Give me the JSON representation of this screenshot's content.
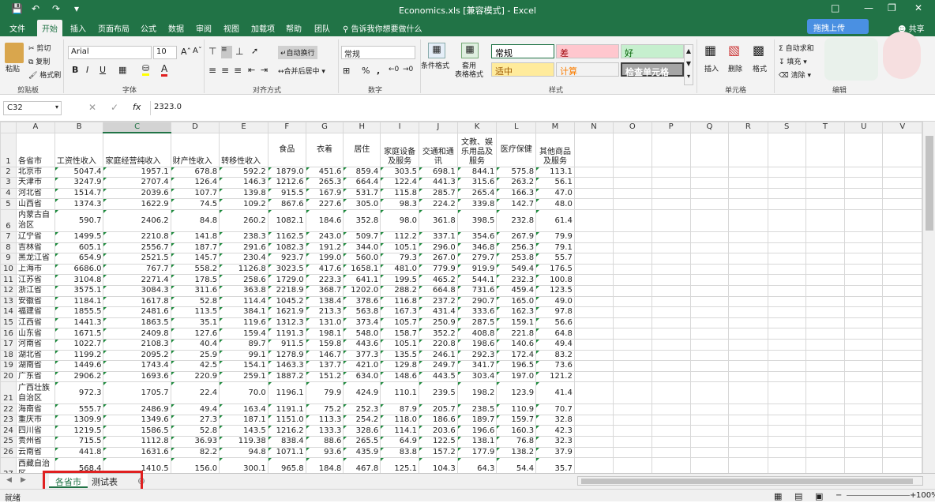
{
  "window": {
    "title": "Economics.xls  [兼容模式]  -  Excel"
  },
  "tabs": [
    "文件",
    "开始",
    "插入",
    "页面布局",
    "公式",
    "数据",
    "审阅",
    "视图",
    "加载项",
    "帮助",
    "团队"
  ],
  "active_tab": "开始",
  "tell_me": "告诉我你想要做什么",
  "share": "共享",
  "upload": "拖拽上传",
  "ribbon": {
    "clipboard": {
      "paste": "粘贴",
      "cut": "剪切",
      "copy": "复制",
      "format_painter": "格式刷",
      "label": "剪贴板"
    },
    "font": {
      "name": "Arial",
      "size": "10",
      "bold": "B",
      "italic": "I",
      "underline": "U",
      "label": "字体"
    },
    "alignment": {
      "wrap": "自动换行",
      "merge": "合并后居中",
      "label": "对齐方式"
    },
    "number": {
      "format": "常规",
      "percent": "%",
      "comma": ",",
      "label": "数字"
    },
    "styles": {
      "conditional": "条件格式",
      "table": "套用\n表格格式",
      "label": "样式",
      "cells": [
        {
          "text": "常规",
          "bg": "#ffffff",
          "fg": "#000000"
        },
        {
          "text": "差",
          "bg": "#ffc7ce",
          "fg": "#9c0006"
        },
        {
          "text": "好",
          "bg": "#c6efce",
          "fg": "#006100"
        },
        {
          "text": "适中",
          "bg": "#ffeb9c",
          "fg": "#9c5700"
        },
        {
          "text": "计算",
          "bg": "#f2f2f2",
          "fg": "#fa7d00"
        },
        {
          "text": "检查单元格",
          "bg": "#a5a5a5",
          "fg": "#ffffff"
        }
      ]
    },
    "cells": {
      "insert": "插入",
      "delete": "删除",
      "format": "格式",
      "label": "单元格"
    },
    "editing": {
      "autosum": "自动求和",
      "fill": "填充",
      "clear": "清除",
      "label": "编辑"
    }
  },
  "formula_bar": {
    "name_box": "C32",
    "fx": "fx",
    "value": "2323.0"
  },
  "columns": [
    "A",
    "B",
    "C",
    "D",
    "E",
    "F",
    "G",
    "H",
    "I",
    "J",
    "K",
    "L",
    "M",
    "N",
    "O",
    "P",
    "Q",
    "R",
    "S",
    "T",
    "U",
    "V"
  ],
  "header_row": [
    "各省市",
    "工资性收入",
    "家庭经营纯收入",
    "财产性收入",
    "转移性收入",
    "食品",
    "衣着",
    "居住",
    "家庭设备及服务",
    "交通和通讯",
    "文教、娱乐用品及服务",
    "医疗保健",
    "其他商品及服务"
  ],
  "rows": [
    {
      "n": "2",
      "name": "北京市",
      "v": [
        "5047.4",
        "1957.1",
        "678.8",
        "592.2",
        "1879.0",
        "451.6",
        "859.4",
        "303.5",
        "698.1",
        "844.1",
        "575.8",
        "113.1"
      ]
    },
    {
      "n": "3",
      "name": "天津市",
      "v": [
        "3247.9",
        "2707.4",
        "126.4",
        "146.3",
        "1212.6",
        "265.3",
        "664.4",
        "122.4",
        "441.3",
        "315.6",
        "263.2",
        "56.1"
      ]
    },
    {
      "n": "4",
      "name": "河北省",
      "v": [
        "1514.7",
        "2039.6",
        "107.7",
        "139.8",
        "915.5",
        "167.9",
        "531.7",
        "115.8",
        "285.7",
        "265.4",
        "166.3",
        "47.0"
      ]
    },
    {
      "n": "5",
      "name": "山西省",
      "v": [
        "1374.3",
        "1622.9",
        "74.5",
        "109.2",
        "867.6",
        "227.6",
        "305.0",
        "98.3",
        "224.2",
        "339.8",
        "142.7",
        "48.0"
      ]
    },
    {
      "n": "6",
      "name": "内蒙古自治区",
      "tall": true,
      "v": [
        "590.7",
        "2406.2",
        "84.8",
        "260.2",
        "1082.1",
        "184.6",
        "352.8",
        "98.0",
        "361.8",
        "398.5",
        "232.8",
        "61.4"
      ]
    },
    {
      "n": "7",
      "name": "辽宁省",
      "v": [
        "1499.5",
        "2210.8",
        "141.8",
        "238.3",
        "1162.5",
        "243.0",
        "509.7",
        "112.2",
        "337.1",
        "354.6",
        "267.9",
        "79.9"
      ]
    },
    {
      "n": "8",
      "name": "吉林省",
      "v": [
        "605.1",
        "2556.7",
        "187.7",
        "291.6",
        "1082.3",
        "191.2",
        "344.0",
        "105.1",
        "296.0",
        "346.8",
        "256.3",
        "79.1"
      ]
    },
    {
      "n": "9",
      "name": "黑龙江省",
      "v": [
        "654.9",
        "2521.5",
        "145.7",
        "230.4",
        "923.7",
        "199.0",
        "560.0",
        "79.3",
        "267.0",
        "279.7",
        "253.8",
        "55.7"
      ]
    },
    {
      "n": "10",
      "name": "上海市",
      "v": [
        "6686.0",
        "767.7",
        "558.2",
        "1126.8",
        "3023.5",
        "417.6",
        "1658.1",
        "481.0",
        "779.9",
        "919.9",
        "549.4",
        "176.5"
      ]
    },
    {
      "n": "11",
      "name": "江苏省",
      "v": [
        "3104.8",
        "2271.4",
        "178.5",
        "258.6",
        "1729.0",
        "223.3",
        "641.1",
        "199.5",
        "465.2",
        "544.1",
        "232.3",
        "100.8"
      ]
    },
    {
      "n": "12",
      "name": "浙江省",
      "v": [
        "3575.1",
        "3084.3",
        "311.6",
        "363.8",
        "2218.9",
        "368.7",
        "1202.0",
        "288.2",
        "664.8",
        "731.6",
        "459.4",
        "123.5"
      ]
    },
    {
      "n": "13",
      "name": "安徽省",
      "v": [
        "1184.1",
        "1617.8",
        "52.8",
        "114.4",
        "1045.2",
        "138.4",
        "378.6",
        "116.8",
        "237.2",
        "290.7",
        "165.0",
        "49.0"
      ]
    },
    {
      "n": "14",
      "name": "福建省",
      "v": [
        "1855.5",
        "2481.6",
        "113.5",
        "384.1",
        "1621.9",
        "213.3",
        "563.8",
        "167.3",
        "431.4",
        "333.6",
        "162.3",
        "97.8"
      ]
    },
    {
      "n": "15",
      "name": "江西省",
      "v": [
        "1441.3",
        "1863.5",
        "35.1",
        "119.6",
        "1312.3",
        "131.0",
        "373.4",
        "105.7",
        "250.9",
        "287.5",
        "159.1",
        "56.6"
      ]
    },
    {
      "n": "16",
      "name": "山东省",
      "v": [
        "1671.5",
        "2409.8",
        "127.6",
        "159.4",
        "1191.3",
        "198.1",
        "548.0",
        "158.7",
        "352.2",
        "408.8",
        "221.8",
        "64.8"
      ]
    },
    {
      "n": "17",
      "name": "河南省",
      "v": [
        "1022.7",
        "2108.3",
        "40.4",
        "89.7",
        "911.5",
        "159.8",
        "443.6",
        "105.1",
        "220.8",
        "198.6",
        "140.6",
        "49.4"
      ]
    },
    {
      "n": "18",
      "name": "湖北省",
      "v": [
        "1199.2",
        "2095.2",
        "25.9",
        "99.1",
        "1278.9",
        "146.7",
        "377.3",
        "135.5",
        "246.1",
        "292.3",
        "172.4",
        "83.2"
      ]
    },
    {
      "n": "19",
      "name": "湖南省",
      "v": [
        "1449.6",
        "1743.4",
        "42.5",
        "154.1",
        "1463.3",
        "137.7",
        "421.0",
        "129.8",
        "249.7",
        "341.7",
        "196.5",
        "73.6"
      ]
    },
    {
      "n": "20",
      "name": "广东省",
      "v": [
        "2906.2",
        "1693.6",
        "220.9",
        "259.1",
        "1887.2",
        "151.2",
        "634.0",
        "148.6",
        "443.5",
        "303.4",
        "197.0",
        "121.2"
      ]
    },
    {
      "n": "21",
      "name": "广西壮族自治区",
      "tall": true,
      "v": [
        "972.3",
        "1705.7",
        "22.4",
        "70.0",
        "1196.1",
        "79.9",
        "424.9",
        "110.1",
        "239.5",
        "198.2",
        "123.9",
        "41.4"
      ]
    },
    {
      "n": "22",
      "name": "海南省",
      "v": [
        "555.7",
        "2486.9",
        "49.4",
        "163.4",
        "1191.1",
        "75.2",
        "252.3",
        "87.9",
        "205.7",
        "238.5",
        "110.9",
        "70.7"
      ]
    },
    {
      "n": "23",
      "name": "重庆市",
      "v": [
        "1309.9",
        "1349.6",
        "27.3",
        "187.1",
        "1151.0",
        "113.3",
        "254.2",
        "118.0",
        "186.6",
        "189.7",
        "159.7",
        "32.8"
      ]
    },
    {
      "n": "24",
      "name": "四川省",
      "v": [
        "1219.5",
        "1586.5",
        "52.8",
        "143.5",
        "1216.2",
        "133.3",
        "328.6",
        "114.1",
        "203.6",
        "196.6",
        "160.3",
        "42.3"
      ]
    },
    {
      "n": "25",
      "name": "贵州省",
      "v": [
        "715.5",
        "1112.8",
        "36.93",
        "119.38",
        "838.4",
        "88.6",
        "265.5",
        "64.9",
        "122.5",
        "138.1",
        "76.8",
        "32.3"
      ]
    },
    {
      "n": "26",
      "name": "云南省",
      "v": [
        "441.8",
        "1631.6",
        "82.2",
        "94.8",
        "1071.1",
        "93.6",
        "435.9",
        "83.8",
        "157.2",
        "177.9",
        "138.2",
        "37.9"
      ]
    },
    {
      "n": "27",
      "name": "西藏自治区",
      "tall": true,
      "v": [
        "568.4",
        "1410.5",
        "156.0",
        "300.1",
        "965.8",
        "184.8",
        "467.8",
        "125.1",
        "104.3",
        "64.3",
        "54.4",
        "35.7"
      ]
    }
  ],
  "sheets": [
    "各省市",
    "测试表"
  ],
  "active_sheet": "各省市",
  "status": {
    "mode": "就绪",
    "zoom": "100%"
  }
}
